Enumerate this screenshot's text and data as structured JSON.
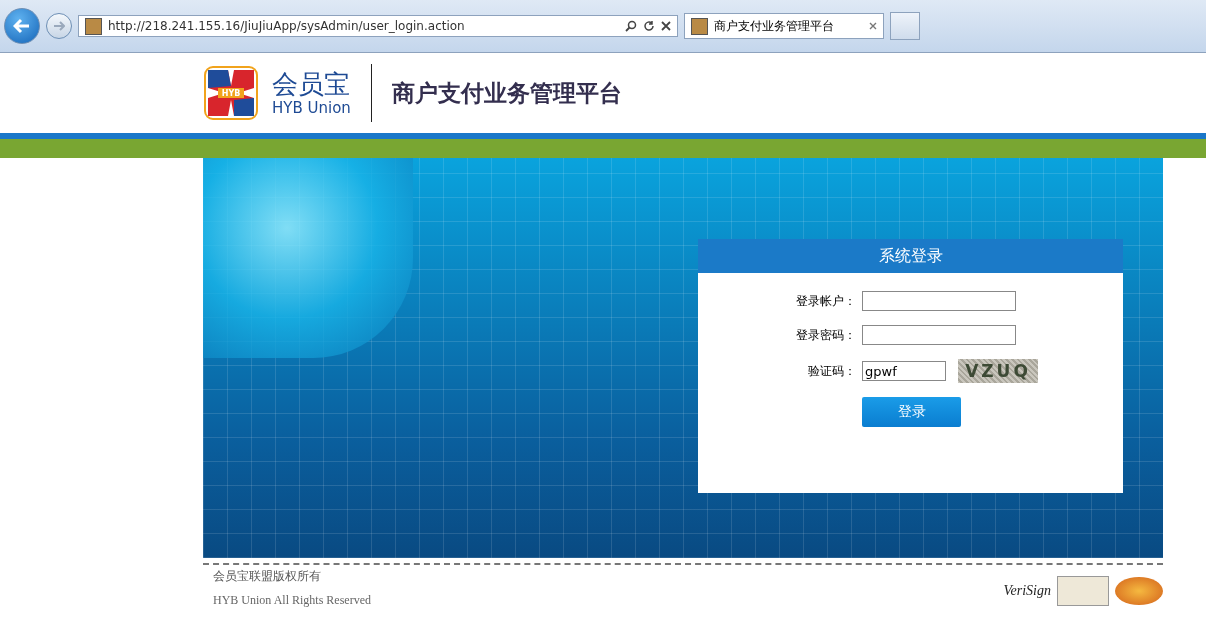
{
  "browser": {
    "address": "http://218.241.155.16/JiuJiuApp/sysAdmin/user_login.action",
    "tabs": [
      {
        "title": "商户支付业务管理平台",
        "selected": true
      }
    ]
  },
  "header": {
    "logo_cn": "会员宝",
    "logo_en": "HYB Union",
    "logo_badge": "HYB",
    "title": "商户支付业务管理平台"
  },
  "login": {
    "title": "系统登录",
    "fields": [
      {
        "label": "登录帐户：",
        "kind": "text"
      },
      {
        "label": "登录密码：",
        "kind": "password"
      },
      {
        "label": "验证码：",
        "value": "gpwf",
        "kind": "captcha",
        "captcha": "VZUQ"
      }
    ],
    "submit": "登录"
  },
  "footer": {
    "copyright_cn": "会员宝联盟版权所有",
    "copyright_en": "HYB Union All Rights Reserved",
    "badges": [
      "VeriSign"
    ]
  }
}
